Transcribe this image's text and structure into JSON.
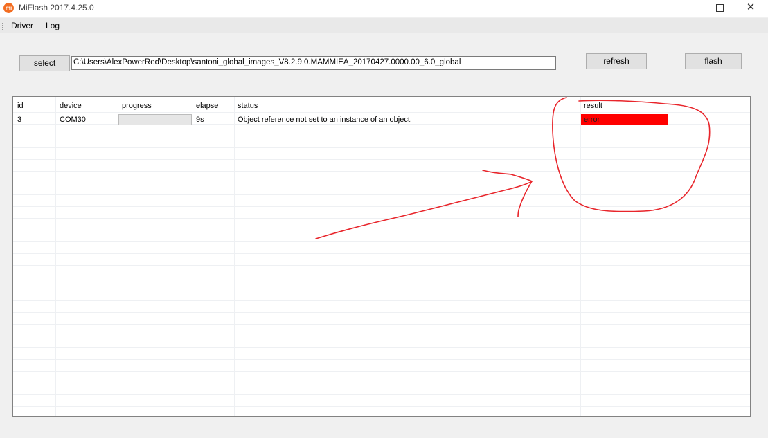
{
  "window": {
    "title": "MiFlash 2017.4.25.0",
    "icon_text": "mi",
    "icon_color": "#f36d21"
  },
  "menu": {
    "driver": "Driver",
    "log": "Log"
  },
  "toolbar": {
    "select_label": "select",
    "path_value": "C:\\Users\\AlexPowerRed\\Desktop\\santoni_global_images_V8.2.9.0.MAMMIEA_20170427.0000.00_6.0_global",
    "refresh_label": "refresh",
    "flash_label": "flash"
  },
  "table": {
    "headers": {
      "id": "id",
      "device": "device",
      "progress": "progress",
      "elapse": "elapse",
      "status": "status",
      "result": "result"
    },
    "rows": [
      {
        "id": "3",
        "device": "COM30",
        "progress": 0,
        "elapse": "9s",
        "status": "Object reference not set to an instance of an object.",
        "result": "error"
      }
    ]
  },
  "colors": {
    "error": "#ff0000",
    "annotation": "#e8252b"
  }
}
